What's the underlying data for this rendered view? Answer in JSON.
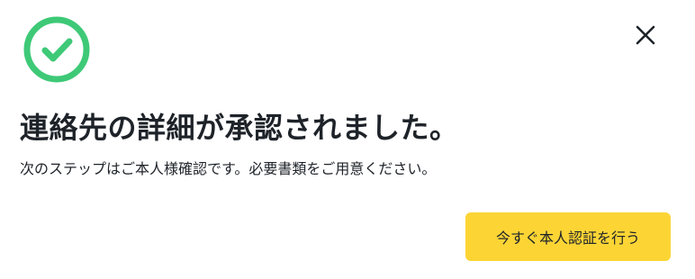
{
  "dialog": {
    "title": "連絡先の詳細が承認されました。",
    "description": "次のステップはご本人様確認です。必要書類をご用意ください。",
    "primary_button_label": "今すぐ本人認証を行う",
    "close_icon": "close-icon",
    "status_icon": "check-circle-icon"
  },
  "colors": {
    "success": "#3ec977",
    "accent": "#fcd535",
    "text": "#1e2329"
  }
}
